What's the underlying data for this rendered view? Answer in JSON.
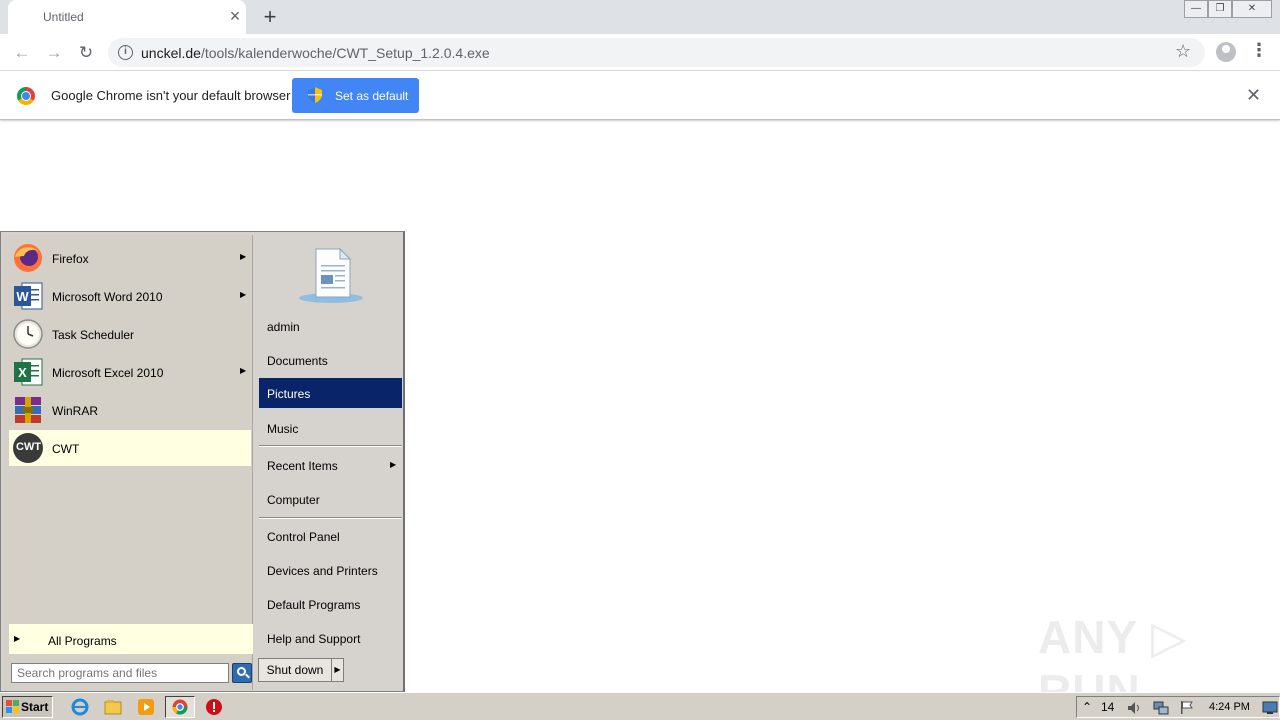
{
  "browser": {
    "tab_title": "Untitled",
    "tab_close": "×",
    "new_tab": "+",
    "window_controls": {
      "minimize": "—",
      "restore": "❐",
      "close": "✕"
    },
    "nav": {
      "back": "←",
      "forward": "→",
      "reload": "↻"
    },
    "url_host": "unckel.de",
    "url_path": "/tools/kalenderwoche/CWT_Setup_1.2.0.4.exe",
    "info_glyph": "i",
    "star_glyph": "☆",
    "menu_glyph": "⋮",
    "infobar": {
      "message": "Google Chrome isn't your default browser",
      "button_label": "Set as default",
      "close_glyph": "✕"
    }
  },
  "start_menu": {
    "programs": [
      {
        "label": "Firefox",
        "icon": "firefox-icon",
        "has_submenu": true
      },
      {
        "label": "Microsoft Word 2010",
        "icon": "word-icon",
        "has_submenu": true
      },
      {
        "label": "Task Scheduler",
        "icon": "clock-icon",
        "has_submenu": false
      },
      {
        "label": "Microsoft Excel 2010",
        "icon": "excel-icon",
        "has_submenu": true
      },
      {
        "label": "WinRAR",
        "icon": "winrar-icon",
        "has_submenu": false
      },
      {
        "label": "CWT",
        "icon": "cwt-icon",
        "icon_text": "CWT",
        "has_submenu": false
      }
    ],
    "all_programs": "All Programs",
    "search_placeholder": "Search programs and files",
    "places": [
      {
        "label": "admin"
      },
      {
        "label": "Documents"
      },
      {
        "label": "Pictures",
        "selected": true
      },
      {
        "label": "Music"
      },
      {
        "label": "Recent Items",
        "has_submenu": true
      },
      {
        "label": "Computer"
      },
      {
        "label": "Control Panel"
      },
      {
        "label": "Devices and Printers"
      },
      {
        "label": "Default Programs"
      },
      {
        "label": "Help and Support"
      }
    ],
    "shutdown_label": "Shut down",
    "submenu_arrow": "▶"
  },
  "taskbar": {
    "start_label": "Start",
    "tray_number": "14",
    "tray_up_glyph": "⌃",
    "clock": "4:24 PM"
  },
  "watermark": "ANY ▷ RUN",
  "colors": {
    "chrome_blue": "#4285f4",
    "selection_navy": "#0a246a",
    "highlight_yellow": "#ffffe1",
    "classic_gray": "#d4d0c8"
  }
}
